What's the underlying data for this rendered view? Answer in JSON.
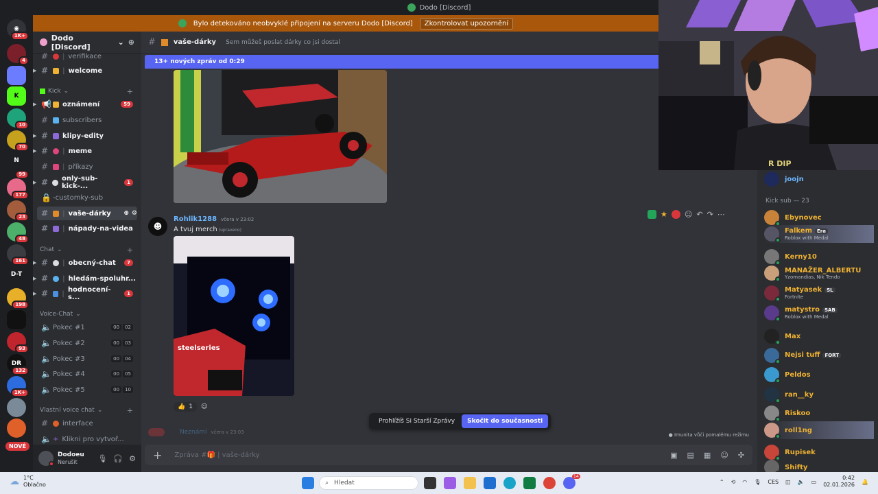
{
  "window": {
    "title": "Dodo [Discord]"
  },
  "banner": {
    "text": "Bylo detekováno neobvyklé připojení na serveru Dodo [Discord]",
    "button": "Zkontrolovat upozornění"
  },
  "server_badges": [
    "1K+",
    "4",
    "",
    "",
    "10",
    "70",
    "",
    "99",
    "177",
    "23",
    "48",
    "161",
    "",
    "198",
    "",
    "93",
    "132",
    "1K+",
    "",
    ""
  ],
  "server_labels": {
    "dt": "D-T",
    "dr": "DR"
  },
  "new_label": "NOVÉ",
  "guild": {
    "name": "Dodo [Discord]"
  },
  "channels": {
    "verifikace": "verifikace",
    "welcome": "welcome",
    "cat_kick": "Kick",
    "oznameni": "oznámení",
    "oznameni_cnt": "59",
    "subscribers": "subscribers",
    "klipy": "klipy-edity",
    "meme": "meme",
    "prikazy": "příkazy",
    "onlysub": "only-sub-kick-...",
    "onlysub_cnt": "1",
    "customky": "-customky-sub",
    "vase": "vaše-dárky",
    "napady": "nápady-na-videa",
    "cat_chat": "Chat",
    "obecny": "obecný-chat",
    "obecny_cnt": "7",
    "hledam": "hledám-spoluhr...",
    "hodnoceni": "hodnocení-s...",
    "hodnoceni_cnt": "1",
    "cat_voice": "Voice-Chat",
    "voice": [
      {
        "name": "Pokec #1",
        "a": "00",
        "b": "02"
      },
      {
        "name": "Pokec #2",
        "a": "00",
        "b": "03"
      },
      {
        "name": "Pokec #3",
        "a": "00",
        "b": "04"
      },
      {
        "name": "Pokec #4",
        "a": "00",
        "b": "05"
      },
      {
        "name": "Pokec #5",
        "a": "00",
        "b": "10"
      }
    ],
    "cat_custom": "Vlastní voice chat",
    "interface": "interface",
    "klikni": "Klikni pro vytvoř..."
  },
  "user": {
    "name": "Dodoeu",
    "status": "Nerušit"
  },
  "header": {
    "channel": "vaše-dárky",
    "topic": "Sem můžeš poslat dárky co jsi dostal"
  },
  "newbar": "13+ nových zpráv od 0:29",
  "message": {
    "author": "Rohlik1288",
    "time": "včera v 23:02",
    "text": "A tvuj merch",
    "edited": "(upraveno)",
    "reaction_count": "1",
    "image_text": "steelseries"
  },
  "prev_author": "Neznámí",
  "prev_time": "včera v 23:03",
  "jump": {
    "text": "Prohlížíš Si Starší Zprávy",
    "button": "Skočit do současnosti"
  },
  "slowmode": "Imunita vůči pomalému režimu",
  "composer": {
    "placeholder": "Zpráva #🎁 | vaše-dárky"
  },
  "webcam_text": "R DIP",
  "members": {
    "top": "joojn",
    "category": "Kick sub — 23",
    "list": [
      {
        "name": "Ebynovec",
        "status": "",
        "tag": ""
      },
      {
        "name": "Falkem",
        "status": "Roblox with Medal",
        "tag": "Era"
      },
      {
        "name": "Kerny10",
        "status": "",
        "tag": ""
      },
      {
        "name": "MANAŽER_ALBERTU",
        "status": "Yzomandias, Nik Tendo",
        "tag": ""
      },
      {
        "name": "Matyasek",
        "status": "Fortnite",
        "tag": "SL"
      },
      {
        "name": "matystro",
        "status": "Roblox with Medal",
        "tag": "SAB"
      },
      {
        "name": "Max",
        "status": "",
        "tag": ""
      },
      {
        "name": "Nejsi tuff",
        "status": "",
        "tag": "FORT"
      },
      {
        "name": "Peldos",
        "status": "",
        "tag": ""
      },
      {
        "name": "ran__ky",
        "status": "",
        "tag": ""
      },
      {
        "name": "Riskoo",
        "status": "",
        "tag": ""
      },
      {
        "name": "roll1ng",
        "status": "",
        "tag": ""
      },
      {
        "name": "Rupisek",
        "status": "",
        "tag": ""
      },
      {
        "name": "Shifty",
        "status": "",
        "tag": ""
      }
    ]
  },
  "taskbar": {
    "temp": "1°C",
    "weather": "Oblačno",
    "search": "Hledat",
    "lang": "CES",
    "time": "0:42",
    "date": "02.01.2026",
    "discord_badge": "14"
  },
  "colors": {
    "accent": "#5865f2",
    "banner": "#a8570b",
    "danger": "#da373c",
    "online": "#23a55a"
  }
}
